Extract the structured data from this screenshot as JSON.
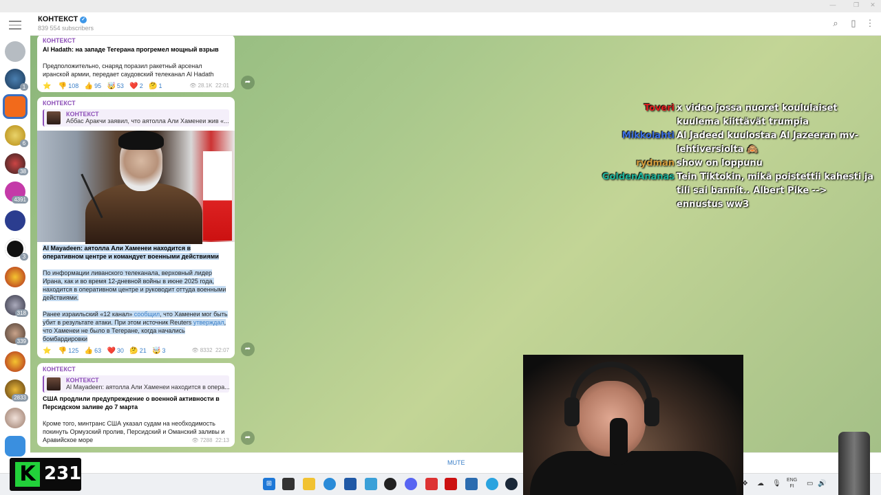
{
  "header": {
    "channel_name": "КОНТЕКСТ",
    "subscribers": "839 554 subscribers"
  },
  "sidebar": {
    "badges": [
      "1",
      "6",
      "38",
      "4391",
      "3",
      "318",
      "339",
      "2833"
    ]
  },
  "messages": [
    {
      "channel": "КОНТЕКСТ",
      "title": "Al Hadath: на западе Тегерана прогремел мощный взрыв",
      "body": "Предположительно, снаряд поразил ракетный арсенал иранской армии, передает саудовский телеканал Al Hadath",
      "reactions": [
        {
          "emoji": "⭐",
          "count": ""
        },
        {
          "emoji": "👎",
          "count": "108"
        },
        {
          "emoji": "👍",
          "count": "95"
        },
        {
          "emoji": "🤯",
          "count": "53"
        },
        {
          "emoji": "❤️",
          "count": "2"
        },
        {
          "emoji": "🤔",
          "count": "1"
        }
      ],
      "views": "28.1K",
      "time": "22:01"
    },
    {
      "channel": "КОНТЕКСТ",
      "reply_channel": "КОНТЕКСТ",
      "reply_text": "Аббас Аракчи заявил, что аятолла Али Хаменеи жив «...",
      "title": "Al Mayadeen: аятолла Али Хаменеи находится в оперативном центре и командует военными действиями",
      "body1": "По информации ливанского телеканала, верховный лидер Ирана, как и во время 12-дневной войны в июне 2025 года, находится в оперативном центре и руководит оттуда военными действиями.",
      "body2_a": "Ранее израильский «12 канал» ",
      "body2_link1": "сообщил",
      "body2_b": ", что Хаменеи мог быть убит в результате атаки. При этом источник Reuters ",
      "body2_link2": "утверждал",
      "body2_c": ", что Хаменеи не было в Тегеране, когда начались бомбардировки",
      "reactions": [
        {
          "emoji": "⭐",
          "count": ""
        },
        {
          "emoji": "👎",
          "count": "125"
        },
        {
          "emoji": "👍",
          "count": "63"
        },
        {
          "emoji": "❤️",
          "count": "30"
        },
        {
          "emoji": "🤔",
          "count": "21"
        },
        {
          "emoji": "🤯",
          "count": "3"
        }
      ],
      "views": "8332",
      "time": "22:07"
    },
    {
      "channel": "КОНТЕКСТ",
      "reply_channel": "КОНТЕКСТ",
      "reply_text": "Al Mayadeen: аятолла Али Хаменеи находится в опера...",
      "title": "США продлили предупреждение о военной активности в Персидском заливе до 7 марта",
      "body": "Кроме того, минтранс США указал судам на необходимость покинуть Ормузский пролив, Персидский и Оманский заливы и Аравийское море",
      "views": "7288",
      "time": "22:13"
    }
  ],
  "stream_chat": [
    {
      "user": "Toveri",
      "color": "#e02020",
      "text": "x video jossa nuoret koululaiset kuulema kiittävät trumpia"
    },
    {
      "user": "Mikkolahti",
      "color": "#3b6fe0",
      "text": "Al Jadeed kuulostaa Al Jazeeran mv-lehtiversiolta 🙈"
    },
    {
      "user": "rydman",
      "color": "#d8a040",
      "text": "show on loppunu"
    },
    {
      "user": "GoldenAnanas",
      "color": "#1fb39a",
      "text": "Tein Tiktokin, mikä poistettii kahesti ja tili sai bannit.. Albert Pike --> ennustus ww3"
    }
  ],
  "composer": {
    "mute_label": "MUTE"
  },
  "taskbar": {
    "lang_top": "ENG",
    "lang_bottom": "FI"
  },
  "overlay_counter": {
    "letter": "K",
    "value": "231"
  }
}
